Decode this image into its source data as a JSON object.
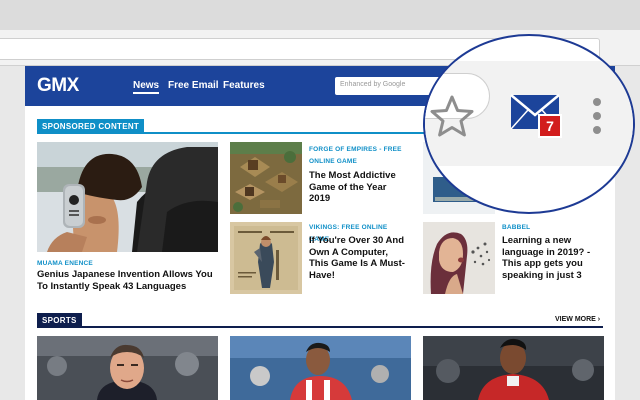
{
  "header": {
    "logo": "GMX",
    "nav": [
      "News",
      "Free Email",
      "Features"
    ],
    "search_placeholder": "Enhanced by Google"
  },
  "sponsored": {
    "label": "SPONSORED CONTENT",
    "items": [
      {
        "category": "MUAMA ENENCE",
        "headline": "Genius Japanese Invention Allows You To Instantly Speak 43 Languages"
      },
      {
        "category": "FORGE OF EMPIRES - FREE ONLINE GAME",
        "headline": "The Most Addictive Game of the Year 2019"
      },
      {
        "category": "VIKINGS: FREE ONLINE GAME",
        "headline": "If You're Over 30 And Own A Computer, This Game Is A Must-Have!"
      },
      {
        "category": "BABBEL",
        "headline": "Learning a new language in 2019? - This app gets you speaking in just 3"
      }
    ]
  },
  "sports": {
    "label": "SPORTS",
    "view_more": "VIEW MORE"
  },
  "extension": {
    "badge_count": "7"
  },
  "colors": {
    "gmx_blue": "#1c449b",
    "accent_cyan": "#0f8fc7",
    "sports_navy": "#0e1e4d",
    "badge_red": "#d21d1d"
  },
  "icons": [
    "star-icon",
    "mail-icon",
    "more-vert-icon",
    "chevron-right-icon"
  ]
}
